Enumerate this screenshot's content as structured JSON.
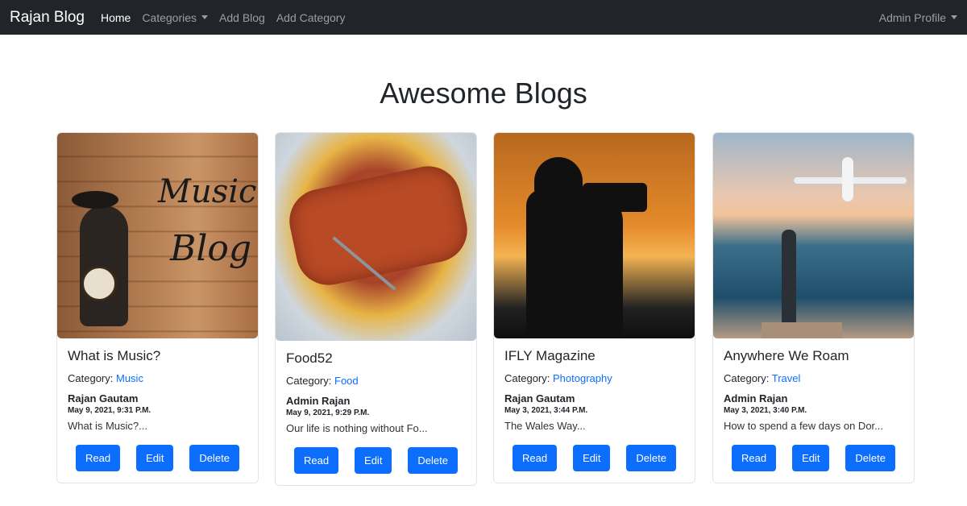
{
  "navbar": {
    "brand": "Rajan Blog",
    "links": [
      {
        "label": "Home",
        "active": true
      },
      {
        "label": "Categories",
        "dropdown": true
      },
      {
        "label": "Add Blog"
      },
      {
        "label": "Add Category"
      }
    ],
    "profile": "Admin Profile"
  },
  "page": {
    "heading": "Awesome Blogs"
  },
  "cards": [
    {
      "title": "What is Music?",
      "category_label": "Category:",
      "category": "Music",
      "author": "Rajan Gautam",
      "date": "May 9, 2021, 9:31 P.M.",
      "excerpt": "What is Music?...",
      "image_text": [
        "Music",
        "Blog"
      ],
      "buttons": {
        "read": "Read",
        "edit": "Edit",
        "delete": "Delete"
      }
    },
    {
      "title": "Food52",
      "category_label": "Category:",
      "category": "Food",
      "author": "Admin Rajan",
      "date": "May 9, 2021, 9:29 P.M.",
      "excerpt": "Our life is nothing without Fo...",
      "buttons": {
        "read": "Read",
        "edit": "Edit",
        "delete": "Delete"
      }
    },
    {
      "title": "IFLY Magazine",
      "category_label": "Category:",
      "category": "Photography",
      "author": "Rajan Gautam",
      "date": "May 3, 2021, 3:44 P.M.",
      "excerpt": "The Wales Way...",
      "buttons": {
        "read": "Read",
        "edit": "Edit",
        "delete": "Delete"
      }
    },
    {
      "title": "Anywhere We Roam",
      "category_label": "Category:",
      "category": "Travel",
      "author": "Admin Rajan",
      "date": "May 3, 2021, 3:40 P.M.",
      "excerpt": "How to spend a few days on Dor...",
      "buttons": {
        "read": "Read",
        "edit": "Edit",
        "delete": "Delete"
      }
    }
  ],
  "colors": {
    "navbar_bg": "#212529",
    "primary": "#0d6efd",
    "link": "#0d6efd"
  }
}
